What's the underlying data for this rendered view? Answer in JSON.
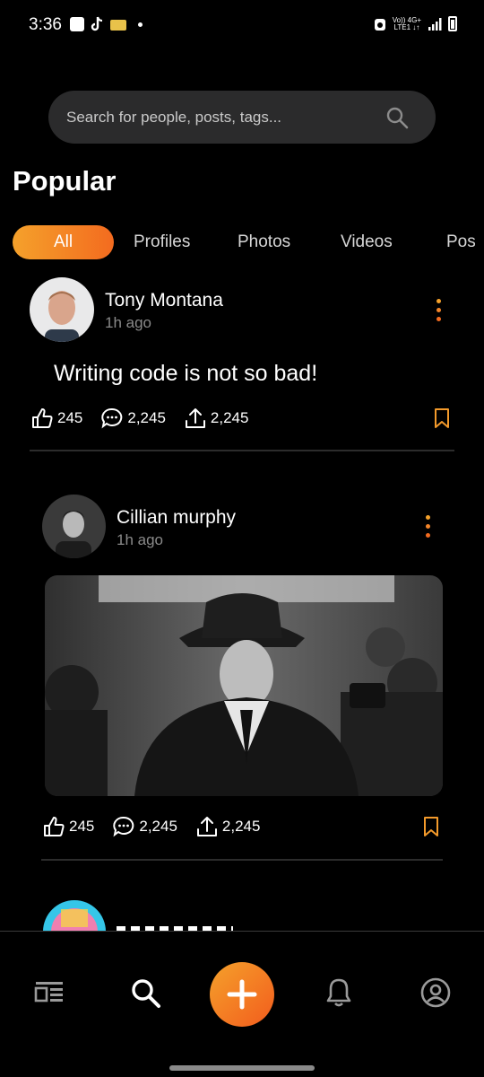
{
  "status_bar": {
    "time": "3:36",
    "carrier_top": "Vo)) 4G+",
    "carrier_bottom": "LTE1 ↓↑"
  },
  "search": {
    "placeholder": "Search for people, posts, tags..."
  },
  "section_title": "Popular",
  "tabs": [
    {
      "label": "All",
      "active": true
    },
    {
      "label": "Profiles"
    },
    {
      "label": "Photos"
    },
    {
      "label": "Videos"
    },
    {
      "label": "Pos"
    }
  ],
  "posts": [
    {
      "author": "Tony Montana",
      "time": "1h ago",
      "text": "Writing code is not so bad!",
      "likes": "245",
      "comments": "2,245",
      "shares": "2,245"
    },
    {
      "author": "Cillian murphy",
      "time": "1h ago",
      "likes": "245",
      "comments": "2,245",
      "shares": "2,245"
    }
  ],
  "colors": {
    "accent_start": "#f5a12b",
    "accent_end": "#f36b1f",
    "background": "#000000"
  },
  "icons": {
    "nav": [
      "feed-icon",
      "search-icon",
      "add-icon",
      "bell-icon",
      "profile-icon"
    ]
  }
}
